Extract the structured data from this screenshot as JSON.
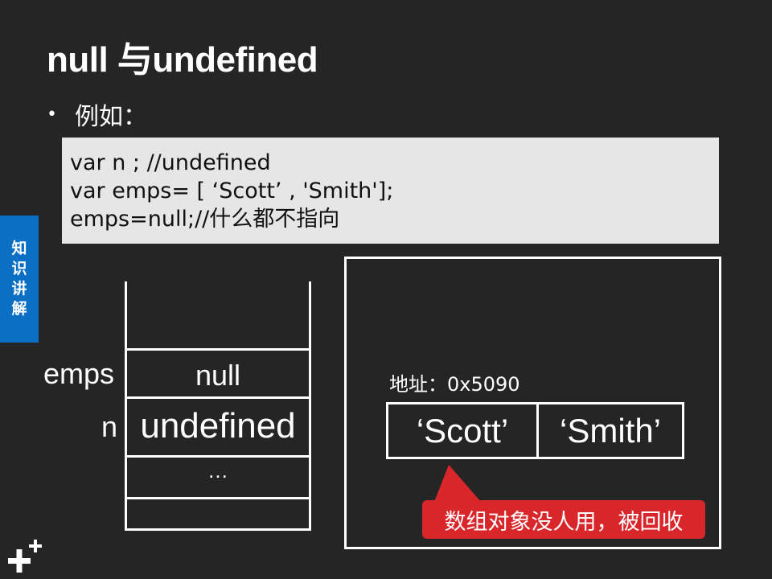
{
  "slide": {
    "title": "null 与undefined",
    "bullet": "例如：",
    "side_tab": [
      "知",
      "识",
      "讲",
      "解"
    ]
  },
  "code": {
    "lines": [
      "var n ; //undefined",
      "var emps= [ ‘Scott’ , 'Smith'];",
      "emps=null;//什么都不指向"
    ]
  },
  "stack": {
    "labels": {
      "emps": "emps",
      "n": "n"
    },
    "cells": {
      "emps_value": "null",
      "n_value": "undefined",
      "more": "…"
    }
  },
  "heap": {
    "address": "地址：0x5090",
    "array": [
      "‘Scott’",
      "‘Smith’"
    ],
    "callout": "数组对象没人用，被回收"
  },
  "colors": {
    "background": "#252525",
    "side_tab": "#0b6fc4",
    "callout": "#d9262b",
    "code_box": "#e6e6e6"
  }
}
